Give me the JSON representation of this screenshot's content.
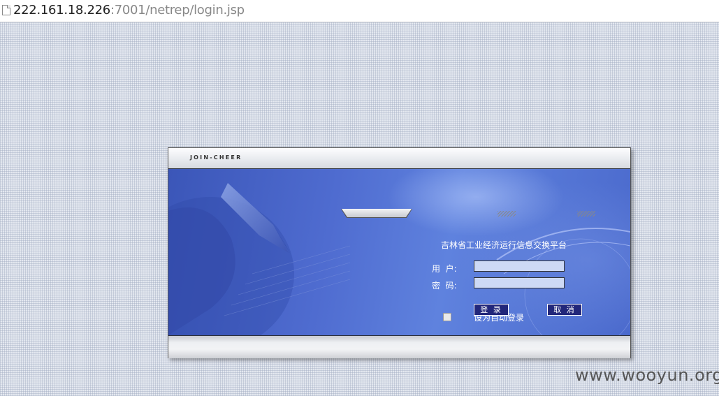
{
  "browser": {
    "url_host": "222.161.18.226",
    "url_rest": ":7001/netrep/login.jsp"
  },
  "login": {
    "brand": "JOIN-CHEER",
    "title": "吉林省工业经济运行信息交换平台",
    "user_label": "用  户:",
    "password_label": "密  码:",
    "user_value": "",
    "password_value": "",
    "auto_login_label": "设为自动登录",
    "login_button": "登 录",
    "cancel_button": "取 消"
  },
  "watermark": "www.wooyun.org",
  "colors": {
    "banner": "#4f6cd0",
    "button": "#22277a",
    "input": "#cdd9f5"
  }
}
